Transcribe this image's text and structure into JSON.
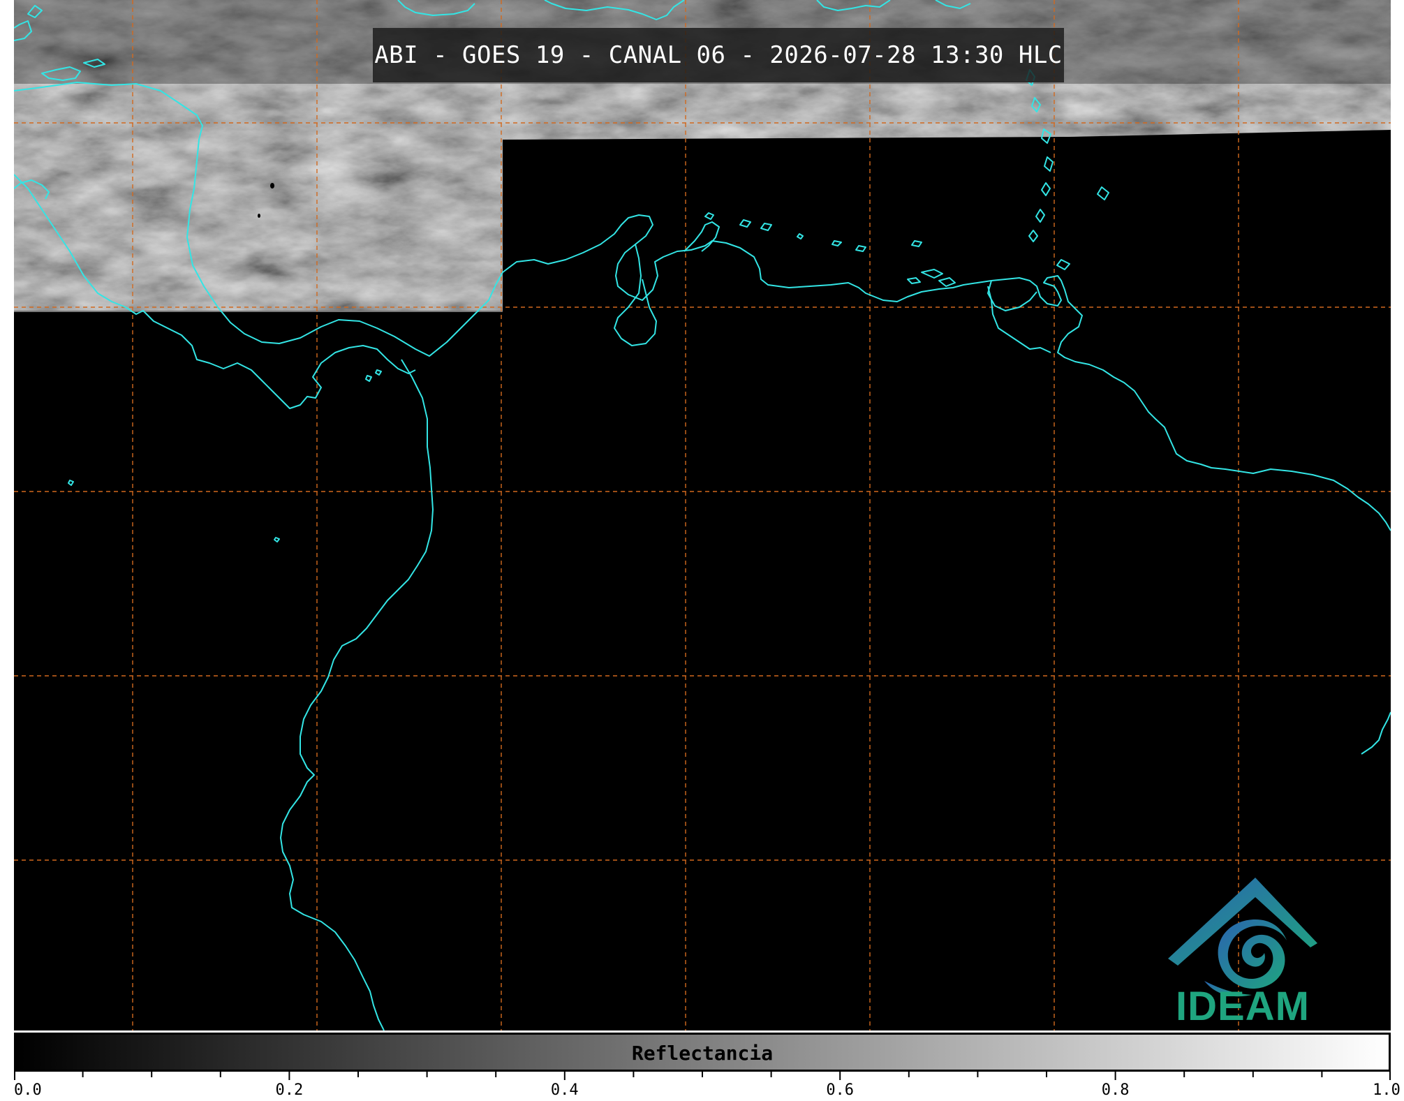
{
  "title": "ABI - GOES 19 - CANAL 06 - 2026-07-28 13:30 HLC",
  "logo": {
    "name": "IDEAM",
    "icon": "ideam-logo-icon"
  },
  "colorbar": {
    "label": "Reflectancia",
    "min": 0.0,
    "max": 1.0,
    "tick_labels": [
      "0.0",
      "0.2",
      "0.4",
      "0.6",
      "0.8",
      "1.0"
    ],
    "minor_tick_step": 0.05,
    "colormap": "grayscale"
  },
  "colors": {
    "coastline": "#33e5e5",
    "grid": "#d2691e",
    "background": "#000000",
    "logo_blue": "#2a64b0",
    "logo_green": "#1fa57f"
  },
  "grid": {
    "style": "dashed"
  }
}
